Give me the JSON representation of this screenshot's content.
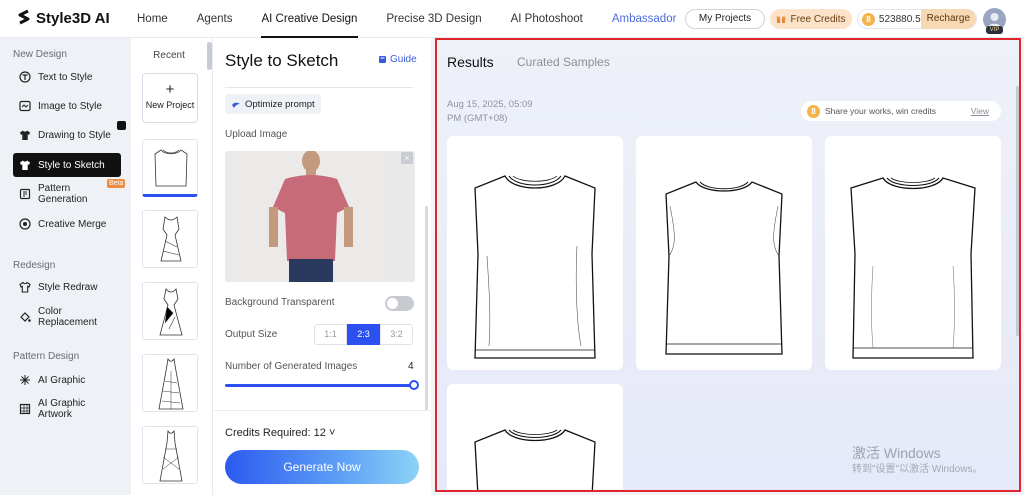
{
  "app": {
    "brand": "Style3D AI"
  },
  "nav": {
    "items": [
      "Home",
      "Agents",
      "AI Creative Design",
      "Precise 3D Design",
      "AI Photoshoot",
      "Ambassador"
    ],
    "my_projects": "My Projects",
    "free_credits": "Free Credits",
    "credit_balance": "523880.5",
    "coin_glyph": "8",
    "recharge": "Recharge",
    "vip": "VIP"
  },
  "sidebar": {
    "sections": [
      {
        "title": "New Design",
        "items": [
          "Text to Style",
          "Image to Style",
          "Drawing to Style",
          "Style to Sketch",
          "Pattern Generation",
          "Creative Merge"
        ]
      },
      {
        "title": "Redesign",
        "items": [
          "Style Redraw",
          "Color Replacement"
        ]
      },
      {
        "title": "Pattern Design",
        "items": [
          "AI Graphic",
          "AI Graphic Artwork"
        ]
      }
    ],
    "active_item": "Style to Sketch",
    "beta_badge": "Beta"
  },
  "recent": {
    "title": "Recent",
    "new_project_plus": "+",
    "new_project": "New Project"
  },
  "panel": {
    "title": "Style to Sketch",
    "guide": "Guide",
    "optimize_prompt": "Optimize prompt",
    "upload_label": "Upload Image",
    "close": "×",
    "background_transparent": "Background Transparent",
    "background_transparent_on": false,
    "output_size_label": "Output Size",
    "output_sizes": [
      "1:1",
      "2:3",
      "3:2"
    ],
    "output_size_selected": "2:3",
    "num_images_label": "Number of Generated Images",
    "num_images": "4",
    "credits_required": "Credits Required: 12",
    "chevron": "˅",
    "generate": "Generate Now"
  },
  "results": {
    "tabs": [
      "Results",
      "Curated Samples"
    ],
    "active_tab": "Results",
    "date_line1": "Aug 15, 2025, 05:09",
    "date_line2": "PM (GMT+08)",
    "share_text": "Share your works, win credits",
    "share_coin": "8",
    "share_view": "View",
    "sketch_count": 4
  },
  "watermark": {
    "line1": "激活 Windows",
    "line2": "转到\"设置\"以激活 Windows。"
  },
  "colors": {
    "accent": "#2c50f0",
    "highlight_border": "#e0262c",
    "coin": "#f3b34c"
  }
}
